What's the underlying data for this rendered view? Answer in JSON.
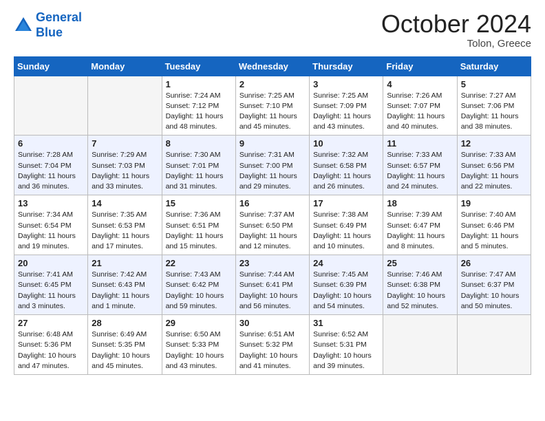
{
  "header": {
    "logo_line1": "General",
    "logo_line2": "Blue",
    "month_title": "October 2024",
    "subtitle": "Tolon, Greece"
  },
  "weekdays": [
    "Sunday",
    "Monday",
    "Tuesday",
    "Wednesday",
    "Thursday",
    "Friday",
    "Saturday"
  ],
  "weeks": [
    [
      {
        "day": "",
        "empty": true
      },
      {
        "day": "",
        "empty": true
      },
      {
        "day": "1",
        "sunrise": "7:24 AM",
        "sunset": "7:12 PM",
        "daylight": "11 hours and 48 minutes."
      },
      {
        "day": "2",
        "sunrise": "7:25 AM",
        "sunset": "7:10 PM",
        "daylight": "11 hours and 45 minutes."
      },
      {
        "day": "3",
        "sunrise": "7:25 AM",
        "sunset": "7:09 PM",
        "daylight": "11 hours and 43 minutes."
      },
      {
        "day": "4",
        "sunrise": "7:26 AM",
        "sunset": "7:07 PM",
        "daylight": "11 hours and 40 minutes."
      },
      {
        "day": "5",
        "sunrise": "7:27 AM",
        "sunset": "7:06 PM",
        "daylight": "11 hours and 38 minutes."
      }
    ],
    [
      {
        "day": "6",
        "sunrise": "7:28 AM",
        "sunset": "7:04 PM",
        "daylight": "11 hours and 36 minutes."
      },
      {
        "day": "7",
        "sunrise": "7:29 AM",
        "sunset": "7:03 PM",
        "daylight": "11 hours and 33 minutes."
      },
      {
        "day": "8",
        "sunrise": "7:30 AM",
        "sunset": "7:01 PM",
        "daylight": "11 hours and 31 minutes."
      },
      {
        "day": "9",
        "sunrise": "7:31 AM",
        "sunset": "7:00 PM",
        "daylight": "11 hours and 29 minutes."
      },
      {
        "day": "10",
        "sunrise": "7:32 AM",
        "sunset": "6:58 PM",
        "daylight": "11 hours and 26 minutes."
      },
      {
        "day": "11",
        "sunrise": "7:33 AM",
        "sunset": "6:57 PM",
        "daylight": "11 hours and 24 minutes."
      },
      {
        "day": "12",
        "sunrise": "7:33 AM",
        "sunset": "6:56 PM",
        "daylight": "11 hours and 22 minutes."
      }
    ],
    [
      {
        "day": "13",
        "sunrise": "7:34 AM",
        "sunset": "6:54 PM",
        "daylight": "11 hours and 19 minutes."
      },
      {
        "day": "14",
        "sunrise": "7:35 AM",
        "sunset": "6:53 PM",
        "daylight": "11 hours and 17 minutes."
      },
      {
        "day": "15",
        "sunrise": "7:36 AM",
        "sunset": "6:51 PM",
        "daylight": "11 hours and 15 minutes."
      },
      {
        "day": "16",
        "sunrise": "7:37 AM",
        "sunset": "6:50 PM",
        "daylight": "11 hours and 12 minutes."
      },
      {
        "day": "17",
        "sunrise": "7:38 AM",
        "sunset": "6:49 PM",
        "daylight": "11 hours and 10 minutes."
      },
      {
        "day": "18",
        "sunrise": "7:39 AM",
        "sunset": "6:47 PM",
        "daylight": "11 hours and 8 minutes."
      },
      {
        "day": "19",
        "sunrise": "7:40 AM",
        "sunset": "6:46 PM",
        "daylight": "11 hours and 5 minutes."
      }
    ],
    [
      {
        "day": "20",
        "sunrise": "7:41 AM",
        "sunset": "6:45 PM",
        "daylight": "11 hours and 3 minutes."
      },
      {
        "day": "21",
        "sunrise": "7:42 AM",
        "sunset": "6:43 PM",
        "daylight": "11 hours and 1 minute."
      },
      {
        "day": "22",
        "sunrise": "7:43 AM",
        "sunset": "6:42 PM",
        "daylight": "10 hours and 59 minutes."
      },
      {
        "day": "23",
        "sunrise": "7:44 AM",
        "sunset": "6:41 PM",
        "daylight": "10 hours and 56 minutes."
      },
      {
        "day": "24",
        "sunrise": "7:45 AM",
        "sunset": "6:39 PM",
        "daylight": "10 hours and 54 minutes."
      },
      {
        "day": "25",
        "sunrise": "7:46 AM",
        "sunset": "6:38 PM",
        "daylight": "10 hours and 52 minutes."
      },
      {
        "day": "26",
        "sunrise": "7:47 AM",
        "sunset": "6:37 PM",
        "daylight": "10 hours and 50 minutes."
      }
    ],
    [
      {
        "day": "27",
        "sunrise": "6:48 AM",
        "sunset": "5:36 PM",
        "daylight": "10 hours and 47 minutes."
      },
      {
        "day": "28",
        "sunrise": "6:49 AM",
        "sunset": "5:35 PM",
        "daylight": "10 hours and 45 minutes."
      },
      {
        "day": "29",
        "sunrise": "6:50 AM",
        "sunset": "5:33 PM",
        "daylight": "10 hours and 43 minutes."
      },
      {
        "day": "30",
        "sunrise": "6:51 AM",
        "sunset": "5:32 PM",
        "daylight": "10 hours and 41 minutes."
      },
      {
        "day": "31",
        "sunrise": "6:52 AM",
        "sunset": "5:31 PM",
        "daylight": "10 hours and 39 minutes."
      },
      {
        "day": "",
        "empty": true
      },
      {
        "day": "",
        "empty": true
      }
    ]
  ]
}
